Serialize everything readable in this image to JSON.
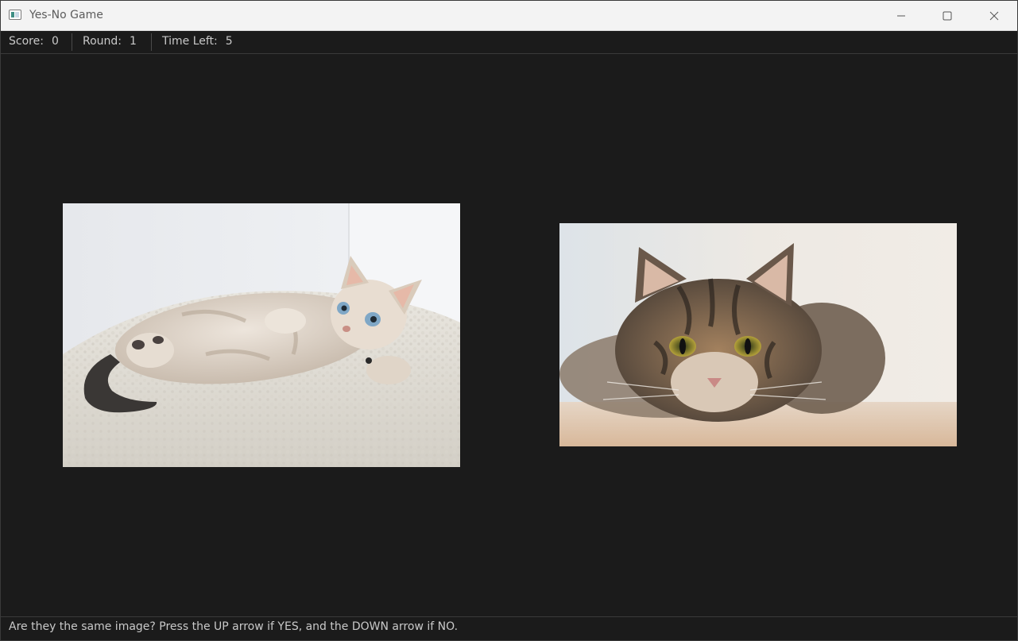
{
  "window": {
    "title": "Yes-No Game"
  },
  "status": {
    "score_label": "Score:",
    "score_value": "0",
    "round_label": "Round:",
    "round_value": "1",
    "time_label": "Time Left:",
    "time_value": "5"
  },
  "images": {
    "left": {
      "icon": "kitten-photo"
    },
    "right": {
      "icon": "tabby-cat-photo"
    }
  },
  "instruction": "Are they the same image? Press the UP arrow if YES, and the DOWN arrow if NO.",
  "colors": {
    "background": "#1b1b1b",
    "titlebar": "#f3f3f3",
    "text": "#c9c9c9"
  }
}
